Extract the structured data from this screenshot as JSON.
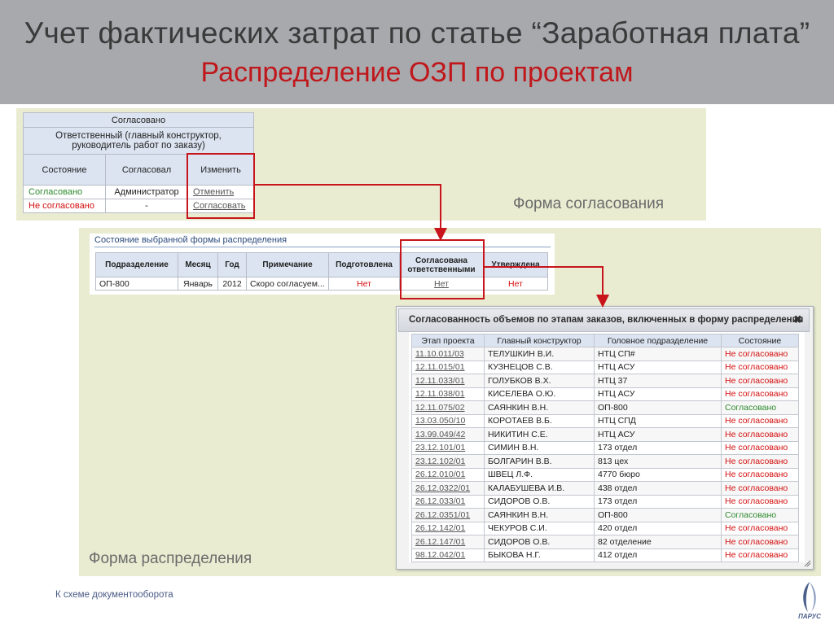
{
  "title": {
    "line1": "Учет фактических затрат по статье “Заработная плата”",
    "line2": "Распределение ОЗП по проектам"
  },
  "approval_form": {
    "label": "Форма согласования",
    "table_title": "Согласовано",
    "responsible": "Ответственный (главный конструктор, руководитель работ по заказу)",
    "columns": [
      "Состояние",
      "Согласовал",
      "Изменить"
    ],
    "rows": [
      {
        "state": "Согласовано",
        "approver": "Администратор",
        "action": "Отменить"
      },
      {
        "state": "Не согласовано",
        "approver": "-",
        "action": "Согласовать"
      }
    ]
  },
  "distribution_form": {
    "label": "Форма распределения",
    "section_title": "Состояние выбранной формы распределения",
    "columns": [
      "Подразделение",
      "Месяц",
      "Год",
      "Примечание",
      "Подготовлена",
      "Согласована ответственными",
      "Утверждена"
    ],
    "row": {
      "department": "ОП-800",
      "month": "Январь",
      "year": "2012",
      "note": "Скоро согласуем...",
      "prepared": "Нет",
      "agreed": "Нет",
      "approved": "Нет"
    }
  },
  "dialog": {
    "title": "Согласованность объемов по этапам заказов, включенных в форму распределения",
    "columns": [
      "Этап проекта",
      "Главный конструктор",
      "Головное подразделение",
      "Состояние"
    ],
    "rows": [
      {
        "stage": "11.10.011/03",
        "designer": "ТЕЛУШКИН В.И.",
        "division": "НТЦ СП#",
        "status": "Не согласовано"
      },
      {
        "stage": "12.11.015/01",
        "designer": "КУЗНЕЦОВ С.В.",
        "division": "НТЦ АСУ",
        "status": "Не согласовано"
      },
      {
        "stage": "12.11.033/01",
        "designer": "ГОЛУБКОВ В.Х.",
        "division": "НТЦ 37",
        "status": "Не согласовано"
      },
      {
        "stage": "12.11.038/01",
        "designer": "КИСЕЛЕВА О.Ю.",
        "division": "НТЦ АСУ",
        "status": "Не согласовано"
      },
      {
        "stage": "12.11.075/02",
        "designer": "САЯНКИН В.Н.",
        "division": "ОП-800",
        "status": "Согласовано"
      },
      {
        "stage": "13.03.050/10",
        "designer": "КОРОТАЕВ В.Б.",
        "division": "НТЦ СПД",
        "status": "Не согласовано"
      },
      {
        "stage": "13.99.049/42",
        "designer": "НИКИТИН С.Е.",
        "division": "НТЦ АСУ",
        "status": "Не согласовано"
      },
      {
        "stage": "23.12.101/01",
        "designer": "СИМИН В.Н.",
        "division": "173 отдел",
        "status": "Не согласовано"
      },
      {
        "stage": "23.12.102/01",
        "designer": "БОЛГАРИН В.В.",
        "division": "813 цех",
        "status": "Не согласовано"
      },
      {
        "stage": "26.12.010/01",
        "designer": "ШВЕЦ Л.Ф.",
        "division": "4770 бюро",
        "status": "Не согласовано"
      },
      {
        "stage": "26.12.0322/01",
        "designer": "КАЛАБУШЕВА И.В.",
        "division": "438 отдел",
        "status": "Не согласовано"
      },
      {
        "stage": "26.12.033/01",
        "designer": "СИДОРОВ О.В.",
        "division": "173 отдел",
        "status": "Не согласовано"
      },
      {
        "stage": "26.12.0351/01",
        "designer": "САЯНКИН В.Н.",
        "division": "ОП-800",
        "status": "Согласовано"
      },
      {
        "stage": "26.12.142/01",
        "designer": "ЧЕКУРОВ С.И.",
        "division": "420 отдел",
        "status": "Не согласовано"
      },
      {
        "stage": "26.12.147/01",
        "designer": "СИДОРОВ О.В.",
        "division": "82 отделение",
        "status": "Не согласовано"
      },
      {
        "stage": "98.12.042/01",
        "designer": "БЫКОВА Н.Г.",
        "division": "412 отдел",
        "status": "Не согласовано"
      }
    ]
  },
  "footer": {
    "link": "К схеме документооборота"
  },
  "colors": {
    "accent_red": "#c8141b",
    "status_green": "#2d8a2d",
    "status_red": "#d40f0f",
    "panel_bg": "#e9ecd1",
    "header_bg": "#a7a9ad"
  },
  "icons": {
    "close": "close-icon",
    "logo": "parus-logo"
  }
}
